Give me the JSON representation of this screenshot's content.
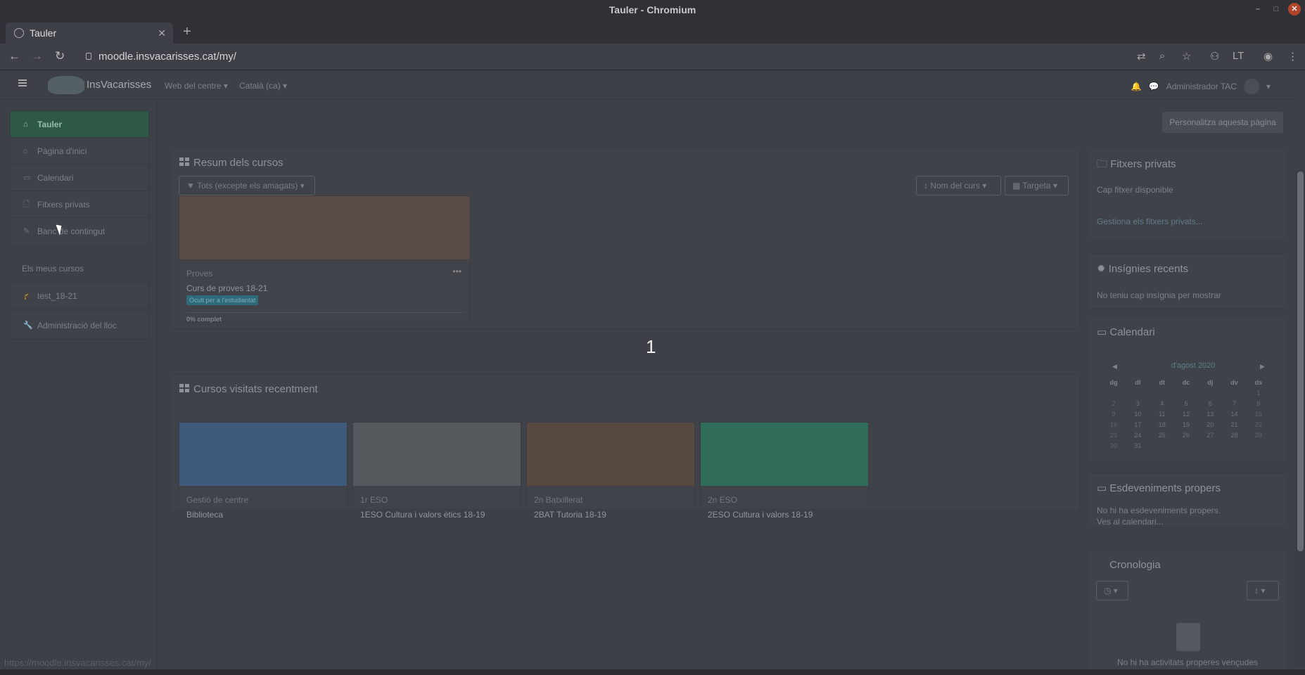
{
  "window": {
    "title": "Tauler - Chromium"
  },
  "browser": {
    "tab_title": "Tauler",
    "url": "moodle.insvacarisses.cat/my/",
    "status_url": "https://moodle.insvacarisses.cat/my/"
  },
  "navbar": {
    "site_name": "InsVacarisses",
    "menu_web": "Web del centre",
    "menu_lang": "Català (ca)",
    "user_name": "Administrador TAC"
  },
  "drawer": {
    "items": [
      {
        "label": "Tauler",
        "icon": "dashboard-icon"
      },
      {
        "label": "Pàgina d'inici",
        "icon": "home-icon"
      },
      {
        "label": "Calendari",
        "icon": "calendar-icon"
      },
      {
        "label": "Fitxers privats",
        "icon": "file-icon"
      },
      {
        "label": "Banc de contingut",
        "icon": "brush-icon"
      }
    ],
    "my_courses_heading": "Els meus cursos",
    "my_courses": [
      {
        "label": "test_18-21",
        "icon": "graduation-cap-icon"
      }
    ],
    "admin": {
      "label": "Administració del lloc",
      "icon": "wrench-icon"
    }
  },
  "main": {
    "customise_button": "Personalitza aquesta pàgina",
    "overview": {
      "title": "Resum dels cursos",
      "filter": "Tots (excepte els amagats)",
      "sort": "Nom del curs",
      "view": "Targeta",
      "course": {
        "category": "Proves",
        "name": "Curs de proves 18-21",
        "badge": "Ocult per a l'estudiantat",
        "progress": "0% complet",
        "progress_value": 0
      }
    },
    "recent": {
      "title": "Cursos visitats recentment",
      "courses": [
        {
          "category": "Gestió de centre",
          "name": "Biblioteca"
        },
        {
          "category": "1r ESO",
          "name": "1ESO Cultura i valors ètics 18-19"
        },
        {
          "category": "2n Batxillerat",
          "name": "2BAT Tutoria 18-19"
        },
        {
          "category": "2n ESO",
          "name": "2ESO Cultura i valors 18-19"
        }
      ]
    },
    "page_number": "1"
  },
  "blocks": {
    "private_files": {
      "title": "Fitxers privats",
      "empty": "Cap fitxer disponible",
      "manage": "Gestiona els fitxers privats..."
    },
    "badges": {
      "title": "Insígnies recents",
      "empty": "No teniu cap insígnia per mostrar"
    },
    "calendar": {
      "title": "Calendari",
      "month": "d'agost 2020",
      "weekdays": [
        "dg",
        "dl",
        "dt",
        "dc",
        "dj",
        "dv",
        "ds"
      ],
      "weeks": [
        [
          "",
          "",
          "",
          "",
          "",
          "",
          "1"
        ],
        [
          "2",
          "3",
          "4",
          "5",
          "6",
          "7",
          "8"
        ],
        [
          "9",
          "10",
          "11",
          "12",
          "13",
          "14",
          "15"
        ],
        [
          "16",
          "17",
          "18",
          "19",
          "20",
          "21",
          "22"
        ],
        [
          "23",
          "24",
          "25",
          "26",
          "27",
          "28",
          "29"
        ],
        [
          "30",
          "31",
          "",
          "",
          "",
          "",
          ""
        ]
      ]
    },
    "events": {
      "title": "Esdeveniments propers",
      "empty": "No hi ha esdeveniments propers.",
      "link": "Ves al calendari..."
    },
    "timeline": {
      "title": "Cronologia",
      "empty": "No hi ha activitats properes vençudes"
    }
  }
}
